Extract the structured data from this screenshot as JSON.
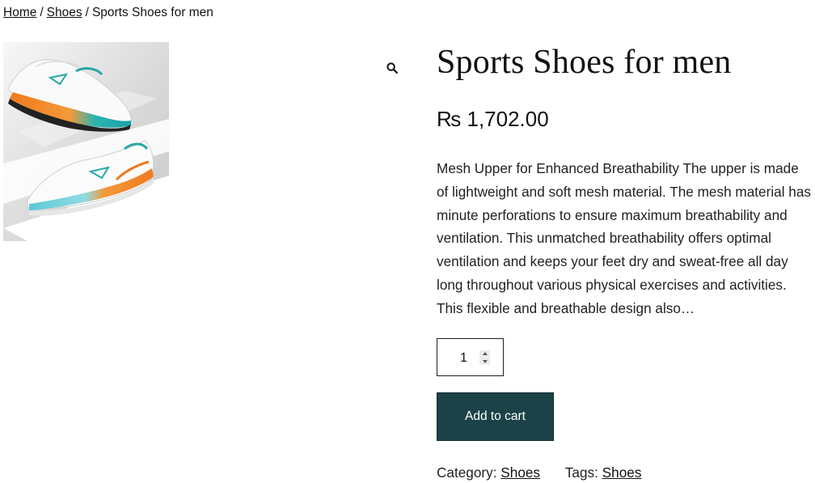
{
  "breadcrumb": {
    "home": "Home",
    "separator": "/",
    "category": "Shoes",
    "current": "Sports Shoes for men"
  },
  "gallery": {
    "image_alt": "Sports Shoes for men",
    "zoom_icon": "magnifier-icon"
  },
  "product": {
    "title": "Sports Shoes for men",
    "price": "₨ 1,702.00",
    "description": "Mesh Upper for Enhanced Breathability The upper is made of lightweight and soft mesh material. The mesh material has minute perforations to ensure maximum breathability and ventilation. This unmatched breathability offers optimal ventilation and keeps your feet dry and sweat-free all day long throughout various physical exercises and activities. This flexible and breathable design also…",
    "quantity": "1",
    "add_to_cart_label": "Add to cart"
  },
  "meta": {
    "category_label": "Category:",
    "category_value": "Shoes",
    "tags_label": "Tags:",
    "tags_value": "Shoes"
  },
  "colors": {
    "button_bg": "#1b4347",
    "button_text": "#ffffff",
    "text": "#111111"
  }
}
